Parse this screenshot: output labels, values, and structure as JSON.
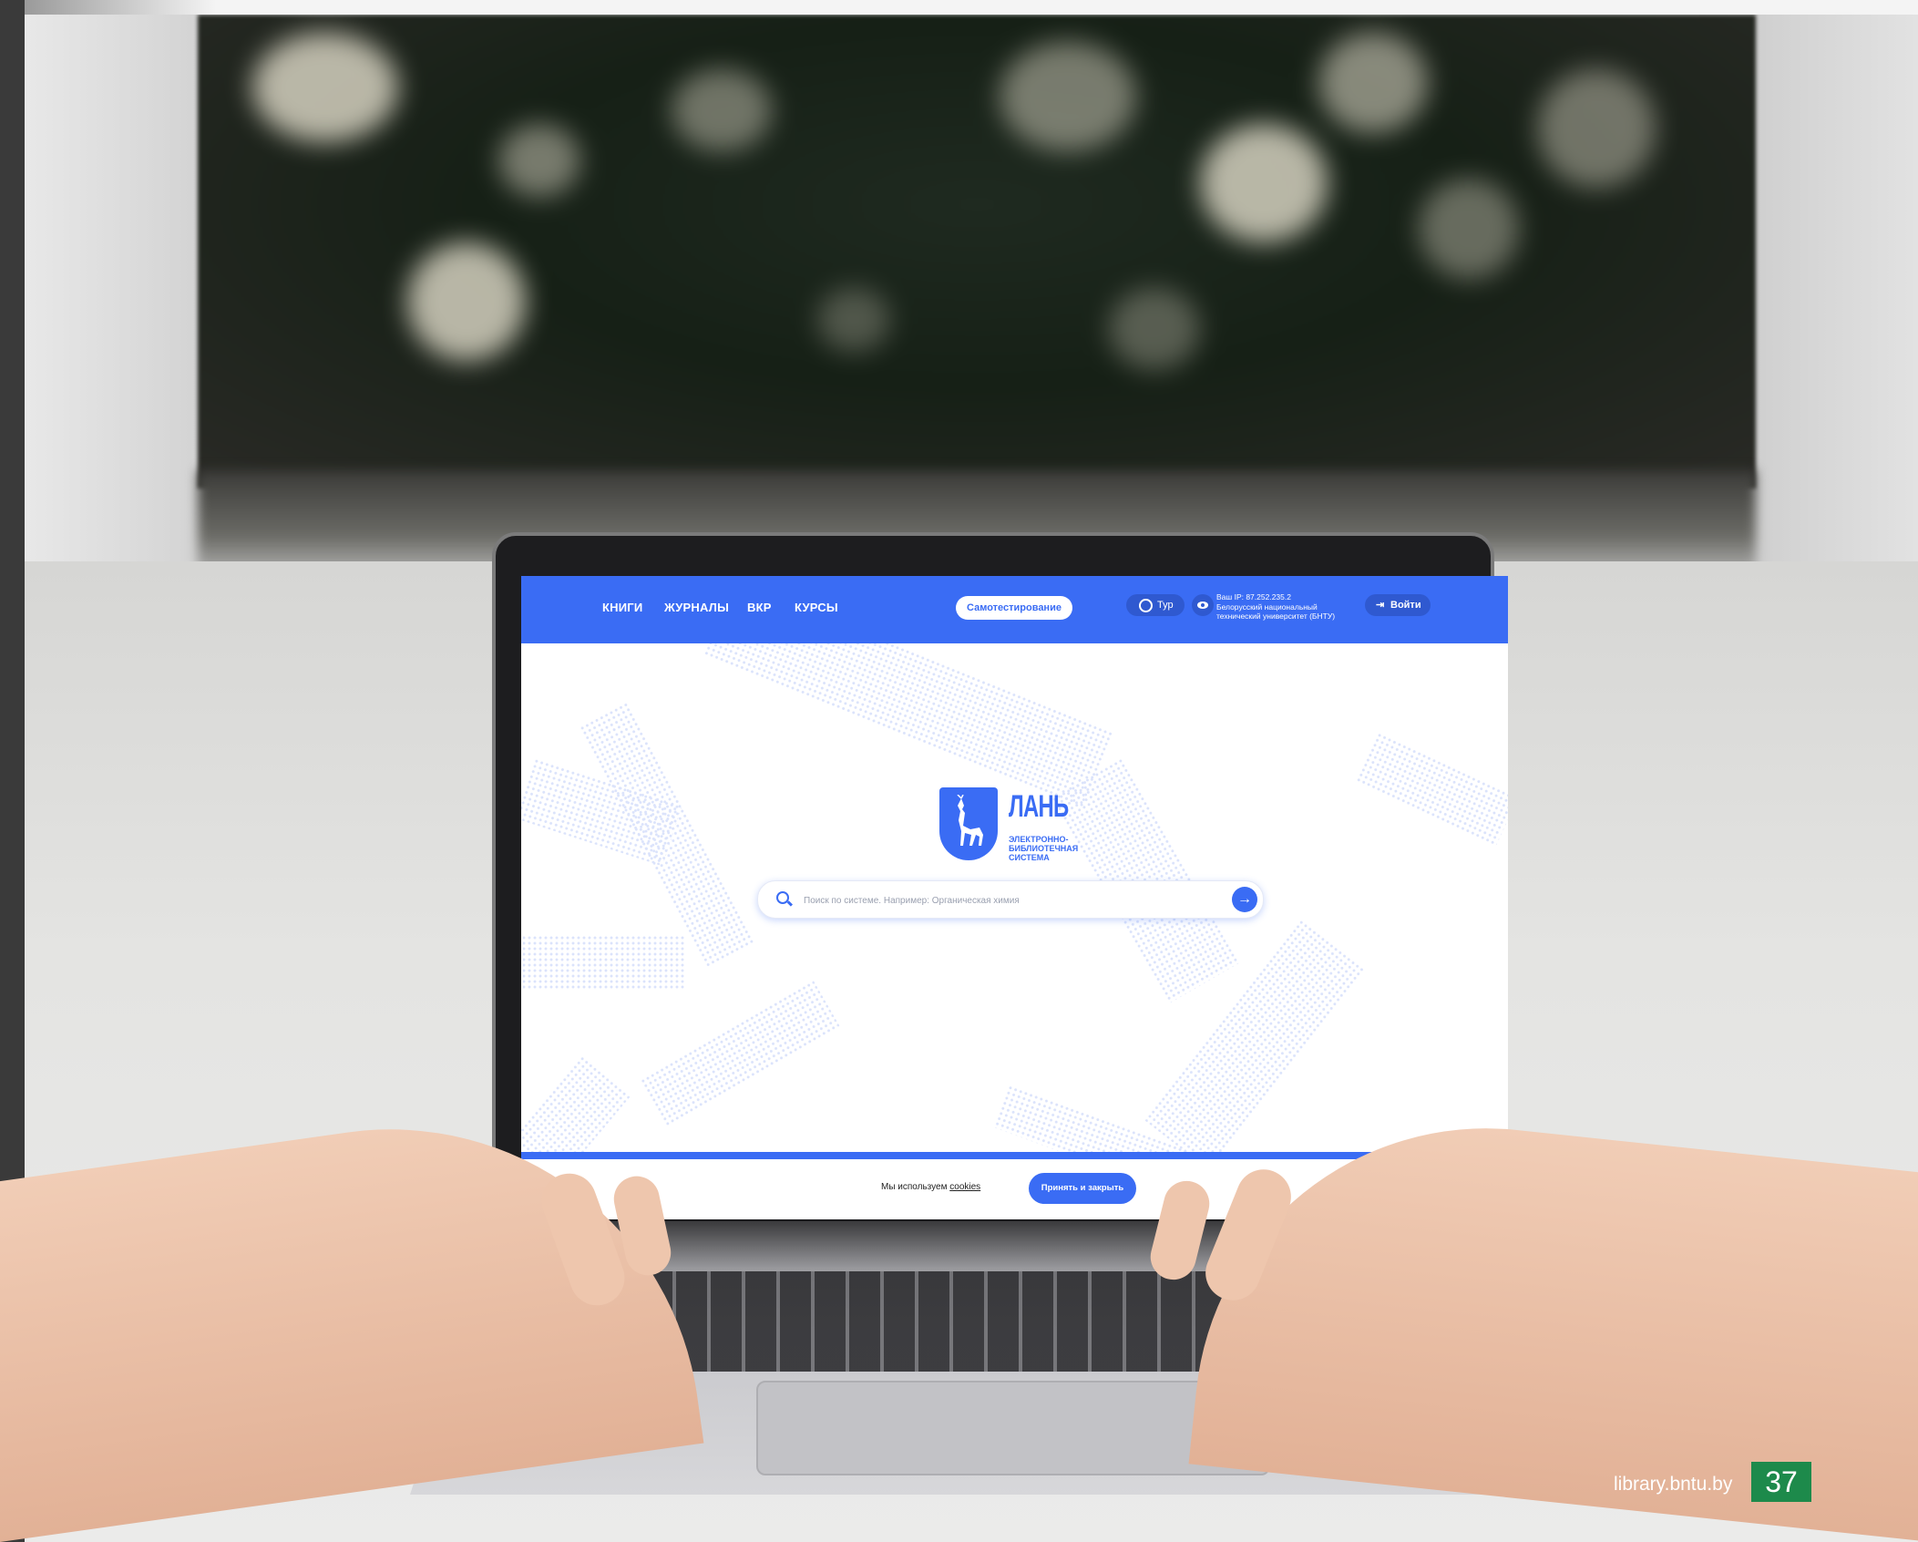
{
  "site": {
    "nav": {
      "links": [
        "КНИГИ",
        "ЖУРНАЛЫ",
        "ВКР",
        "КУРСЫ"
      ],
      "self_test": "Самотестирование",
      "tour": "Тур",
      "ip_info": [
        "Ваш IP: 87.252.235.2",
        "Белорусский национальный",
        "технический университет (БНТУ)"
      ],
      "login": "Войти"
    },
    "logo": {
      "word": "ЛАНЬ",
      "subtitle": [
        "ЭЛЕКТРОННО-",
        "БИБЛИОТЕЧНАЯ",
        "СИСТЕМА"
      ]
    },
    "search": {
      "placeholder": "Поиск по системе. Например: Органическая химия",
      "value": ""
    },
    "cookie": {
      "text": "Мы используем",
      "link": "cookies",
      "button": "Принять и закрыть"
    }
  },
  "footer": {
    "site": "library.bntu.by",
    "page_number": "37"
  },
  "colors": {
    "brand_blue": "#3a6cf4",
    "page_number_green": "#1d8a4b"
  },
  "icons": [
    "search-icon",
    "arrow-right-icon",
    "compass-icon",
    "eye-icon",
    "login-icon",
    "deer-icon"
  ]
}
